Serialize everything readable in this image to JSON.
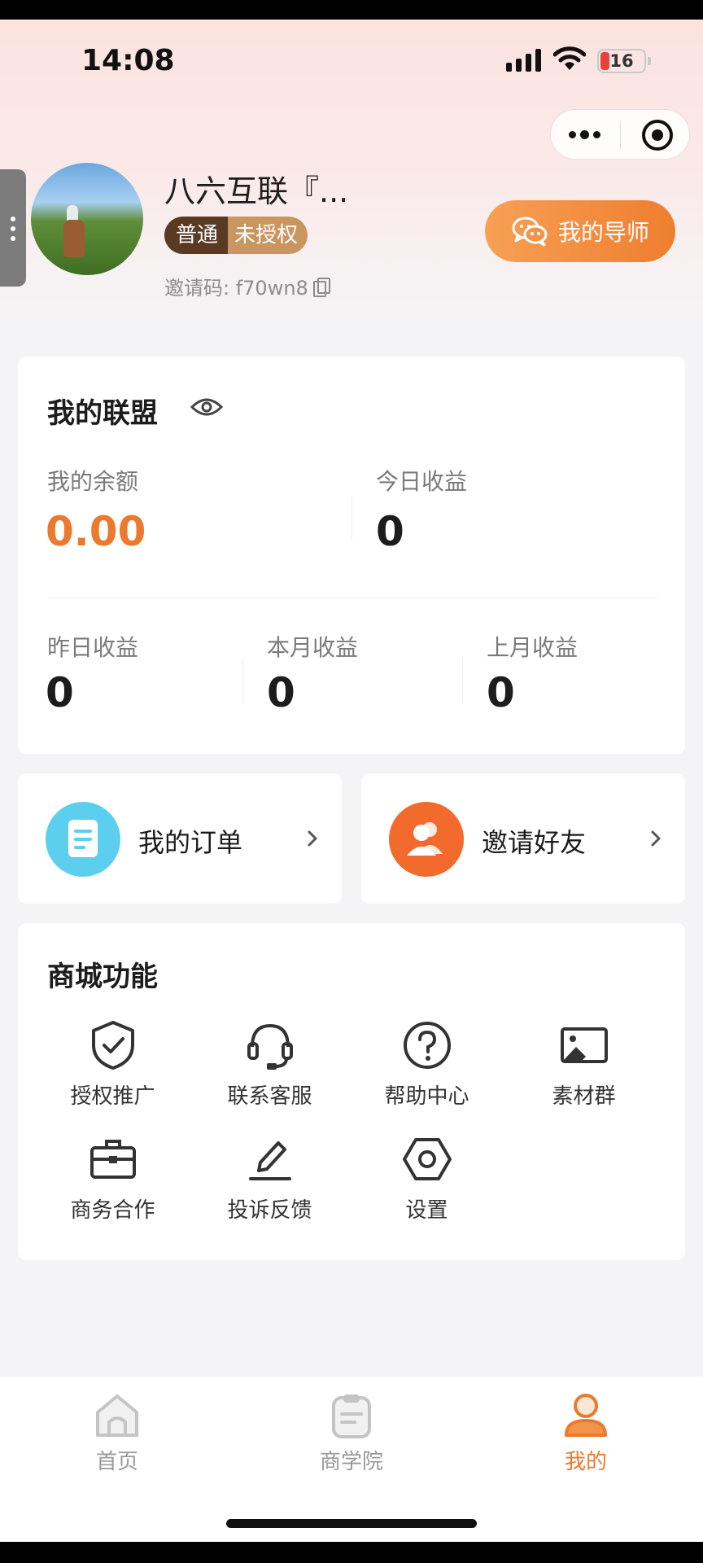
{
  "status_bar": {
    "time": "14:08",
    "battery": "16",
    "icons": [
      "signal-icon",
      "wifi-icon",
      "battery-icon"
    ]
  },
  "capsule": {
    "icons": [
      "more-dots-icon",
      "target-icon"
    ]
  },
  "profile": {
    "username": "八六互联『...",
    "level_tag": "普通",
    "auth_tag": "未授权",
    "invite_code": "邀请码: f70wn8",
    "mentor_button": "我的导师"
  },
  "alliance": {
    "title": "我的联盟",
    "balance_label": "我的余额",
    "balance_value": "0.00",
    "today_label": "今日收益",
    "today_value": "0",
    "yesterday_label": "昨日收益",
    "yesterday_value": "0",
    "this_month_label": "本月收益",
    "this_month_value": "0",
    "last_month_label": "上月收益",
    "last_month_value": "0"
  },
  "quick_actions": {
    "orders": "我的订单",
    "invite": "邀请好友"
  },
  "mall": {
    "title": "商城功能",
    "items": [
      {
        "label": "授权推广",
        "icon": "shield-check-icon"
      },
      {
        "label": "联系客服",
        "icon": "headset-icon"
      },
      {
        "label": "帮助中心",
        "icon": "help-circle-icon"
      },
      {
        "label": "素材群",
        "icon": "image-icon"
      },
      {
        "label": "商务合作",
        "icon": "briefcase-icon"
      },
      {
        "label": "投诉反馈",
        "icon": "pencil-icon"
      },
      {
        "label": "设置",
        "icon": "hexagon-settings-icon"
      }
    ]
  },
  "tabbar": {
    "items": [
      {
        "label": "首页",
        "icon": "home-icon",
        "active": false
      },
      {
        "label": "商学院",
        "icon": "clipboard-icon",
        "active": false
      },
      {
        "label": "我的",
        "icon": "user-icon",
        "active": true
      }
    ]
  },
  "colors": {
    "accent": "#ec7a2e",
    "orders_icon_bg": "#5ccfee",
    "invite_icon_bg": "#f26a2c",
    "level_tag_bg": "#5b3a24",
    "auth_tag_bg": "#c99660"
  }
}
